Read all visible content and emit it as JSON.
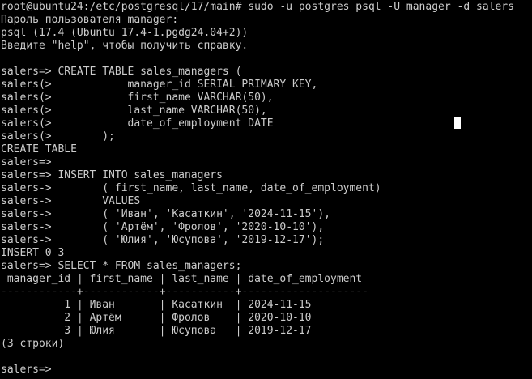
{
  "terminal": {
    "lines": [
      "root@ubuntu24:/etc/postgresql/17/main# sudo -u postgres psql -U manager -d salers",
      "Пароль пользователя manager:",
      "psql (17.4 (Ubuntu 17.4-1.pgdg24.04+2))",
      "Введите \"help\", чтобы получить справку.",
      "",
      "salers=> CREATE TABLE sales_managers (",
      "salers(>            manager_id SERIAL PRIMARY KEY,",
      "salers(>            first_name VARCHAR(50),",
      "salers(>            last_name VARCHAR(50),",
      "salers(>            date_of_employment DATE",
      "salers(>        );",
      "CREATE TABLE",
      "salers=>",
      "salers=> INSERT INTO sales_managers",
      "salers->        ( first_name, last_name, date_of_employment)",
      "salers->        VALUES",
      "salers->        ( 'Иван', 'Касаткин', '2024-11-15'),",
      "salers->        ( 'Артём', 'Фролов', '2020-10-10'),",
      "salers->        ( 'Юлия', 'Юсупова', '2019-12-17');",
      "INSERT 0 3",
      "salers=> SELECT * FROM sales_managers;",
      " manager_id | first_name | last_name | date_of_employment",
      "------------+------------+-----------+--------------------",
      "          1 | Иван       | Касаткин  | 2024-11-15",
      "          2 | Артём      | Фролов    | 2020-10-10",
      "          3 | Юлия       | Юсупова   | 2019-12-17",
      "(3 строки)",
      "",
      "salers=>"
    ]
  }
}
